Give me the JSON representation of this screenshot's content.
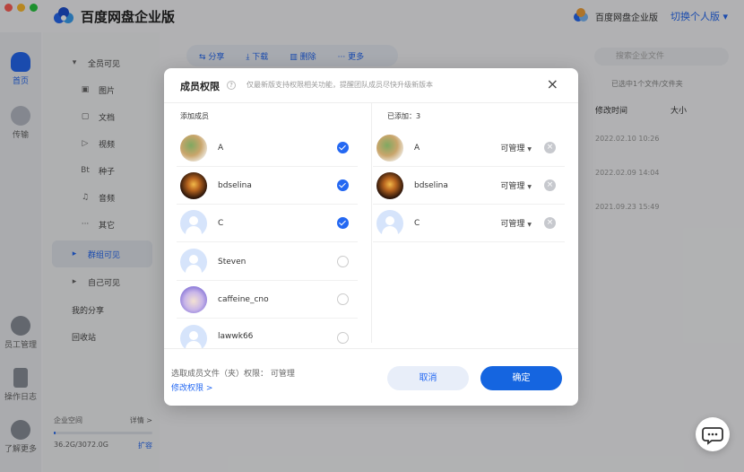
{
  "app": {
    "title": "百度网盘企业版",
    "enterprise_label": "百度网盘企业版",
    "switch_label": "切换个人版 ▾"
  },
  "rail": [
    {
      "label": "首页"
    },
    {
      "label": "传输"
    },
    {
      "label": "员工管理"
    },
    {
      "label": "操作日志"
    },
    {
      "label": "了解更多"
    }
  ],
  "nav": {
    "all_visible": "全员可见",
    "items": [
      {
        "glyph": "▣",
        "label": "图片"
      },
      {
        "glyph": "▢",
        "label": "文档"
      },
      {
        "glyph": "▷",
        "label": "视频"
      },
      {
        "glyph": "Bt",
        "label": "种子"
      },
      {
        "glyph": "♫",
        "label": "音频"
      },
      {
        "glyph": "···",
        "label": "其它"
      }
    ],
    "group_visible": "群组可见",
    "self_visible": "自己可见",
    "my_share": "我的分享",
    "recycle": "回收站",
    "storage_label": "企业空间",
    "storage_detail": "详情 >",
    "storage_usage": "36.2G/3072.0G",
    "expand": "扩容"
  },
  "toolbar": {
    "share": "分享",
    "download": "下载",
    "delete": "删除",
    "more": "更多"
  },
  "search": {
    "placeholder": "搜索企业文件"
  },
  "list": {
    "selected_info": "已选中1个文件/文件夹",
    "col_modified": "修改时间",
    "col_size": "大小",
    "rows": [
      {
        "time": "2022.02.10 10:26",
        "size": "-"
      },
      {
        "time": "2022.02.09 14:04",
        "size": "-"
      },
      {
        "time": "2021.09.23 15:49",
        "size": "-"
      }
    ]
  },
  "dialog": {
    "title": "成员权限",
    "subtitle": "仅最新版支持权限相关功能，提醒团队成员尽快升级新版本",
    "close": "×",
    "add_label": "添加成员",
    "added_label": "已添加：3",
    "members": [
      {
        "name": "A",
        "checked": true,
        "avatar": "photo-a"
      },
      {
        "name": "bdselina",
        "checked": true,
        "avatar": "photo-b"
      },
      {
        "name": "C",
        "checked": true,
        "avatar": "default"
      },
      {
        "name": "Steven",
        "checked": false,
        "avatar": "default"
      },
      {
        "name": "caffeine_cno",
        "checked": false,
        "avatar": "cartoon"
      },
      {
        "name": "lawwk66",
        "checked": false,
        "avatar": "default"
      }
    ],
    "added": [
      {
        "name": "A",
        "perm": "可管理"
      },
      {
        "name": "bdselina",
        "perm": "可管理"
      },
      {
        "name": "C",
        "perm": "可管理"
      }
    ],
    "footer_text": "选取成员文件（夹）权限： 可管理",
    "footer_link": "修改权限 >",
    "cancel": "取消",
    "ok": "确定"
  },
  "colors": {
    "accent": "#2468f2",
    "primary_button": "#1565e0"
  }
}
